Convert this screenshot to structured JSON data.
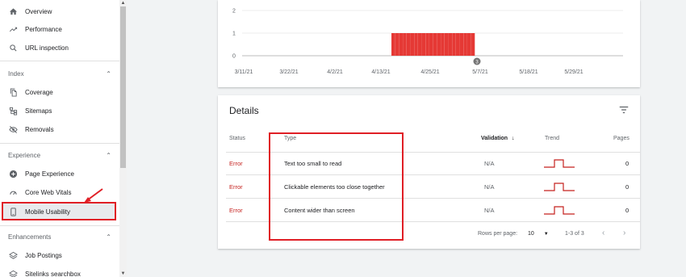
{
  "sidebar": {
    "top_items": [
      {
        "label": "Overview",
        "icon": "home-icon"
      },
      {
        "label": "Performance",
        "icon": "trending-up-icon"
      },
      {
        "label": "URL inspection",
        "icon": "search-icon"
      }
    ],
    "sections": [
      {
        "title": "Index",
        "items": [
          {
            "label": "Coverage",
            "icon": "file-copy-icon"
          },
          {
            "label": "Sitemaps",
            "icon": "sitemap-icon"
          },
          {
            "label": "Removals",
            "icon": "eye-off-icon"
          }
        ]
      },
      {
        "title": "Experience",
        "items": [
          {
            "label": "Page Experience",
            "icon": "add-circle-icon"
          },
          {
            "label": "Core Web Vitals",
            "icon": "speed-gauge-icon"
          },
          {
            "label": "Mobile Usability",
            "icon": "phone-icon"
          }
        ]
      },
      {
        "title": "Enhancements",
        "items": [
          {
            "label": "Job Postings",
            "icon": "layers-icon"
          },
          {
            "label": "Sitelinks searchbox",
            "icon": "layers-icon"
          }
        ]
      }
    ],
    "selected": "Mobile Usability",
    "highlight_color": "#e01f26"
  },
  "chart_data": {
    "type": "bar",
    "y_ticks": [
      "2",
      "1",
      "0"
    ],
    "ylim": [
      0,
      2
    ],
    "x_tick_labels": [
      "3/11/21",
      "3/22/21",
      "4/2/21",
      "4/13/21",
      "4/25/21",
      "5/7/21",
      "5/18/21",
      "5/29/21"
    ],
    "values": [
      1,
      1,
      1,
      1,
      1,
      1,
      1,
      1,
      1,
      1,
      1,
      1,
      1,
      1,
      1,
      1,
      1,
      1,
      1,
      1,
      1,
      1
    ],
    "bar_color": "#e53935",
    "annotation_marker": "3"
  },
  "details": {
    "title": "Details",
    "columns": {
      "status": "Status",
      "type": "Type",
      "validation": "Validation",
      "trend": "Trend",
      "pages": "Pages"
    },
    "rows": [
      {
        "status": "Error",
        "type": "Text too small to read",
        "validation": "N/A",
        "pages": "0"
      },
      {
        "status": "Error",
        "type": "Clickable elements too close together",
        "validation": "N/A",
        "pages": "0"
      },
      {
        "status": "Error",
        "type": "Content wider than screen",
        "validation": "N/A",
        "pages": "0"
      }
    ],
    "pagination": {
      "rows_per_page_label": "Rows per page:",
      "rows_per_page_value": "10",
      "range": "1-3 of 3"
    },
    "error_color": "#c5221f"
  }
}
